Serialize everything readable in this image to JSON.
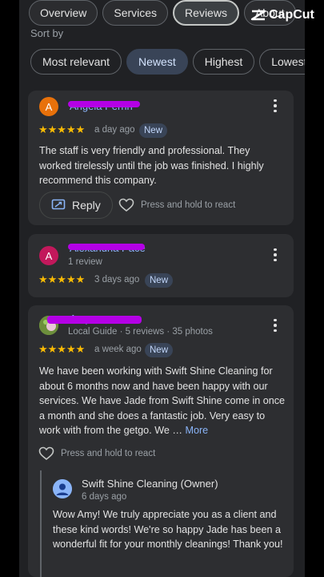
{
  "tabs": [
    {
      "label": "Overview",
      "active": false
    },
    {
      "label": "Services",
      "active": false
    },
    {
      "label": "Reviews",
      "active": true
    },
    {
      "label": "About",
      "active": false
    }
  ],
  "watermark": {
    "label": "CapCut"
  },
  "sort": {
    "label": "Sort by",
    "chips": [
      {
        "label": "Most relevant",
        "active": false
      },
      {
        "label": "Newest",
        "active": true
      },
      {
        "label": "Highest",
        "active": false
      },
      {
        "label": "Lowest",
        "active": false
      }
    ]
  },
  "reviews": [
    {
      "avatar_letter": "A",
      "avatar_color": "#e8710a",
      "author": "Angela Perrin",
      "author_meta": "",
      "rating": 5,
      "stars": "★★★★★",
      "when": "a day ago",
      "badge": "New",
      "text": "The staff is very friendly and professional. They worked tirelessly until the job was finished. I highly recommend this company.",
      "reply_label": "Reply",
      "react_label": "Press and hold to react"
    },
    {
      "avatar_letter": "A",
      "avatar_color": "#c2185b",
      "author": "Alexandria Pace",
      "author_meta": "1 review",
      "rating": 5,
      "stars": "★★★★★",
      "when": "3 days ago",
      "badge": "New"
    },
    {
      "avatar_letter": "",
      "avatar_color": "#7cb342",
      "author": "Amy",
      "author_meta": "Local Guide · 5 reviews · 35 photos",
      "rating": 5,
      "stars": "★★★★★",
      "when": "a week ago",
      "badge": "New",
      "text": "We have been working with Swift Shine Cleaning for about 6 months now and have been happy with our services. We have Jade from Swift Shine come in once a month and she does a fantastic job. Very easy to work with from the getgo. We …",
      "more_label": "More",
      "react_label": "Press and hold to react",
      "owner_reply": {
        "name": "Swift Shine Cleaning (Owner)",
        "when": "6 days ago",
        "text": "Wow Amy! We truly appreciate you as a client and these kind words! We're so happy Jade has been a wonderful fit for your monthly cleanings! Thank you!"
      }
    }
  ],
  "colors": {
    "background": "#202124",
    "card": "#2d2e31",
    "star": "#fbbc04",
    "badge_bg": "#394457",
    "link": "#8ab4f8",
    "redaction": "#b400e6"
  }
}
